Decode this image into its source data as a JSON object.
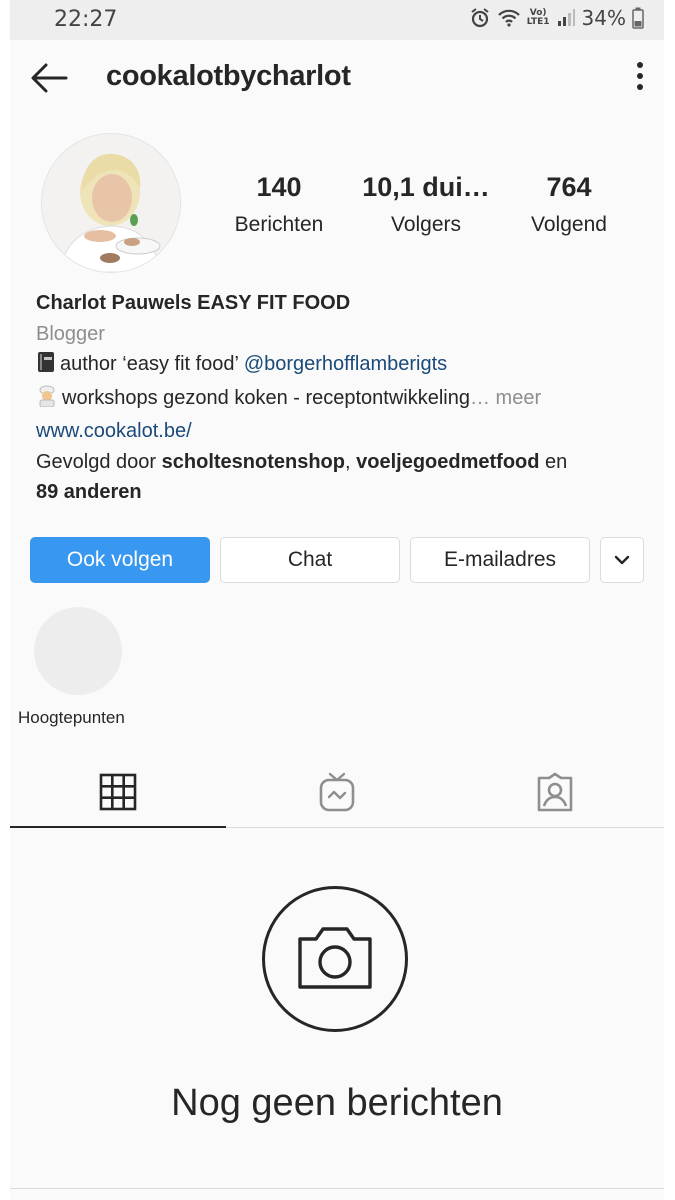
{
  "status_bar": {
    "time": "22:27",
    "network_top": "Vo)",
    "network_bottom": "LTE1",
    "battery": "34%"
  },
  "header": {
    "username": "cookalotbycharlot",
    "back_icon": "arrow-left-icon",
    "menu_icon": "kebab-menu-icon"
  },
  "stats": [
    {
      "value": "140",
      "label": "Berichten"
    },
    {
      "value": "10,1 dui…",
      "label": "Volgers"
    },
    {
      "value": "764",
      "label": "Volgend"
    }
  ],
  "bio": {
    "name": "Charlot Pauwels EASY FIT FOOD",
    "category": "Blogger",
    "line1_text": "author ‘easy fit food’ ",
    "line1_mention": "@borgerhofflamberigts",
    "line2_text": "workshops gezond koken - receptontwikkeling",
    "line2_more": "… meer",
    "website": "www.cookalot.be/",
    "followed_prefix": "Gevolgd door ",
    "followed_user1": "scholtesnotenshop",
    "followed_sep": ", ",
    "followed_user2": "voeljegoedmetfood",
    "followed_and": " en",
    "followed_others": "89 anderen"
  },
  "buttons": {
    "follow": "Ook volgen",
    "chat": "Chat",
    "email": "E-mailadres"
  },
  "highlights": {
    "label": "Hoogtepunten"
  },
  "tabs": [
    {
      "icon": "grid-icon",
      "active": true
    },
    {
      "icon": "igtv-icon",
      "active": false
    },
    {
      "icon": "tagged-icon",
      "active": false
    }
  ],
  "empty_state": {
    "title": "Nog geen berichten",
    "icon": "camera-icon"
  },
  "colors": {
    "accent": "#3897f0",
    "link": "#1b4a7a",
    "muted": "#8e8e8e",
    "text": "#262626"
  }
}
